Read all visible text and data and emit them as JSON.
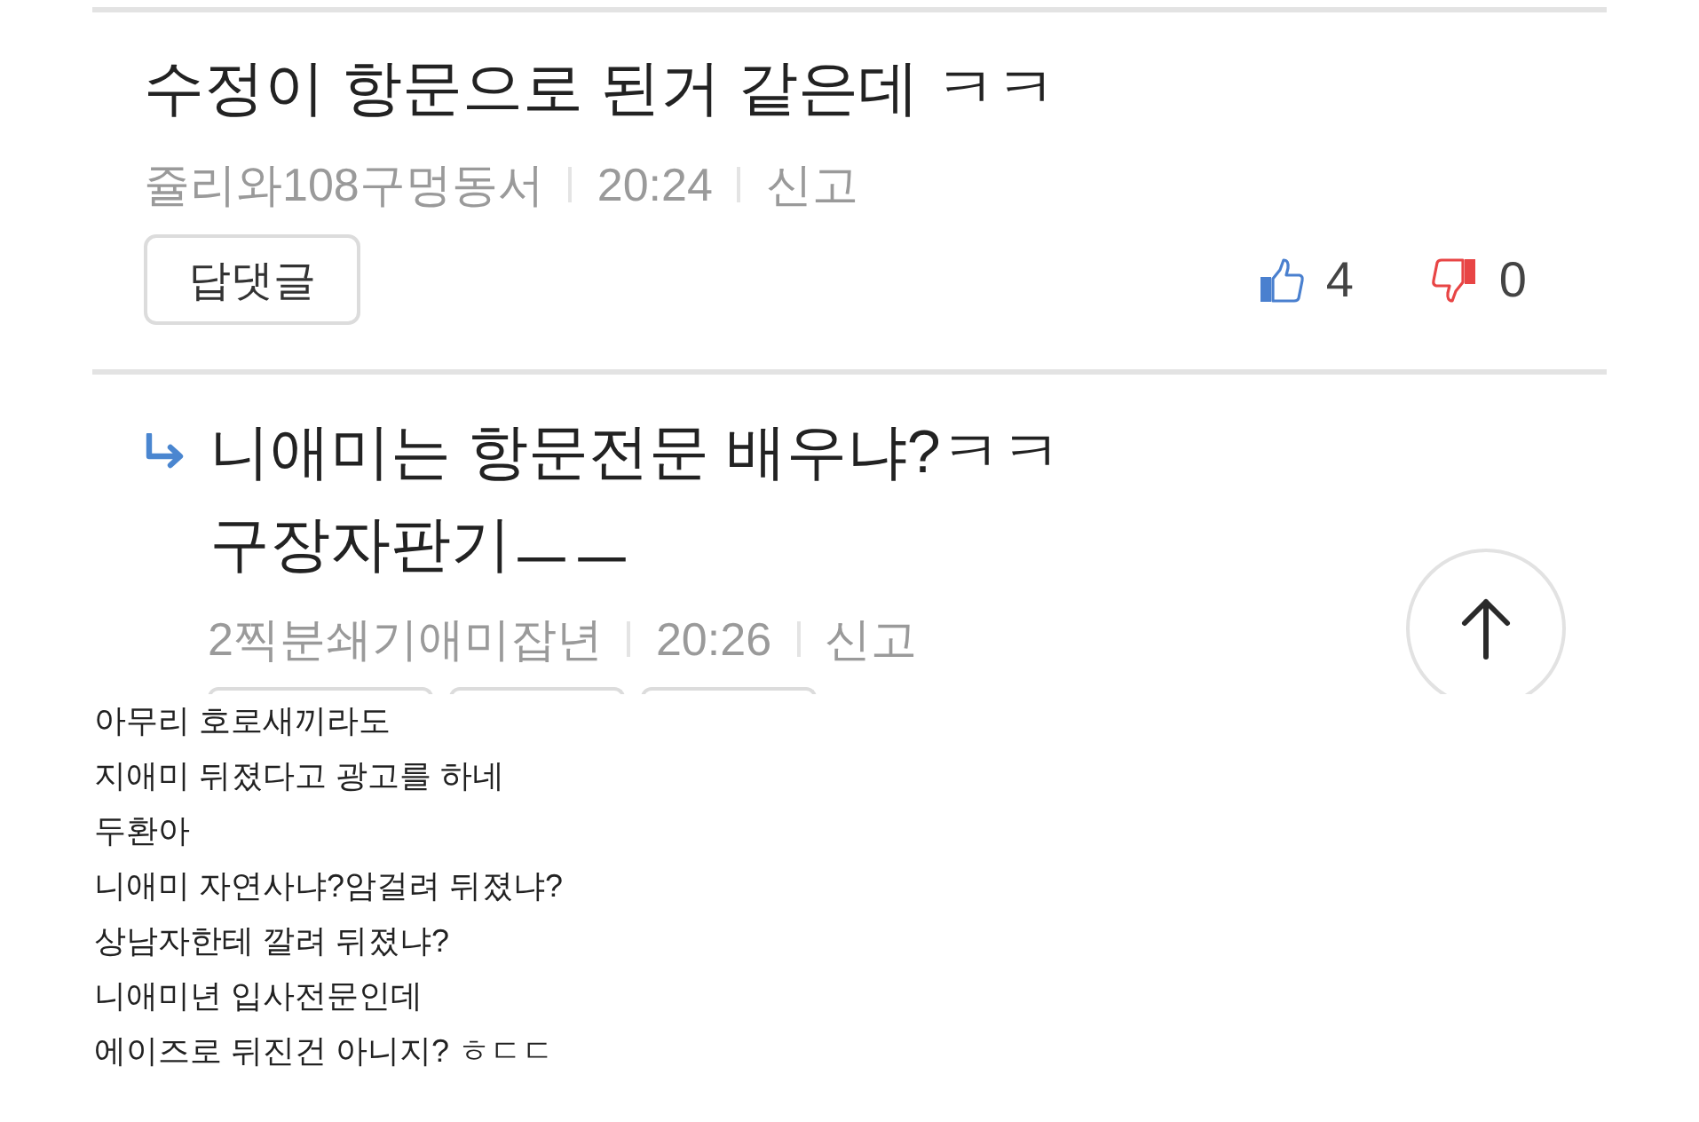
{
  "comments": [
    {
      "kind": "comment",
      "lines": [
        "수정이 항문으로 된거 같은데 ㅋㅋ"
      ],
      "author": "쥴리와108구멍동서",
      "time": "20:24",
      "report": "신고",
      "reply_button": "답댓글",
      "likes": "4",
      "dislikes": "0"
    },
    {
      "kind": "reply",
      "lines": [
        "니애미는 항문전문 배우냐?ㅋㅋ",
        "구장자판기ㅡㅡ"
      ],
      "author": "2찍분쇄기애미잡년",
      "time": "20:26",
      "report": "신고",
      "cut_buttons": [
        {
          "kind": "wide"
        },
        {
          "kind": "narrow"
        },
        {
          "kind": "narrow"
        }
      ]
    }
  ],
  "body_lines": [
    "아무리 호로새끼라도",
    "지애미 뒤졌다고 광고를 하네",
    "두환아",
    "니애미 자연사냐?암걸려 뒤졌냐?",
    "상남자한테 깔려 뒤졌냐?",
    "니애미년 입사전문인데",
    "에이즈로 뒤진건 아니지? ㅎㄷㄷ"
  ]
}
